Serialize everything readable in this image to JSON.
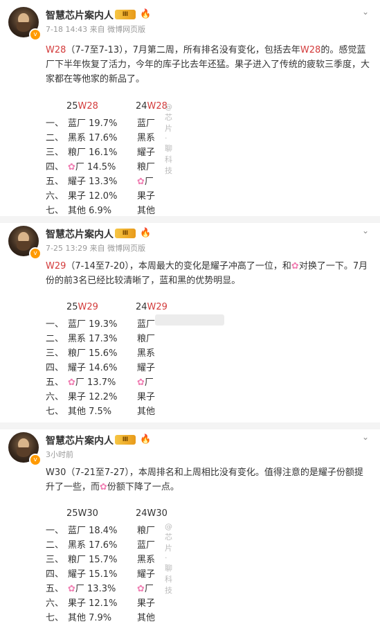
{
  "posts": [
    {
      "username": "智慧芯片案内人",
      "vip_label": "Ⅲ",
      "meta": "7-18 14:43  来自 微博网页版",
      "text_parts": [
        "W28",
        "（7-7至7-13），7月第二周，所有排名没有变化，包括去年",
        "W28",
        "的。感觉蓝厂下半年恢复了活力，今年的库子比去年还猛。果子进入了传统的疲软三季度，大家都在等他家的新品了。"
      ],
      "header_cur_prefix": "25",
      "header_cur_week": "W28",
      "header_prev_prefix": "24",
      "header_prev_week": "W28",
      "watermark": "@ 芯片·聊科技",
      "rows": [
        {
          "idx": "一、",
          "cur": "蓝厂 19.7%",
          "prev": "蓝厂"
        },
        {
          "idx": "二、",
          "cur": "黑系 17.6%",
          "prev": "黑系"
        },
        {
          "idx": "三、",
          "cur": "粮厂 16.1%",
          "prev": "耀子"
        },
        {
          "idx": "四、",
          "cur": "厂 14.5%",
          "cur_flower": true,
          "prev": "粮厂"
        },
        {
          "idx": "五、",
          "cur": "耀子 13.3%",
          "prev": "厂",
          "prev_flower": true
        },
        {
          "idx": "六、",
          "cur": "果子  12.0%",
          "prev": "果子"
        },
        {
          "idx": "七、",
          "cur": "其他  6.9%",
          "prev": "其他"
        }
      ]
    },
    {
      "username": "智慧芯片案内人",
      "vip_label": "Ⅲ",
      "meta": "7-25 13:29  来自 微博网页版",
      "text_parts": [
        "W29",
        "（7-14至7-20），本周最大的变化是耀子冲高了一位，和",
        "对换了一下。7月份的前3名已经比较清晰了，蓝和黑的优势明显。"
      ],
      "header_cur_prefix": "25",
      "header_cur_week": "W29",
      "header_prev_prefix": "24",
      "header_prev_week": "W29",
      "rows": [
        {
          "idx": "一、",
          "cur": "蓝厂 19.3%",
          "prev": "蓝厂"
        },
        {
          "idx": "二、",
          "cur": "黑系 17.3%",
          "prev": "粮厂"
        },
        {
          "idx": "三、",
          "cur": "粮厂 15.6%",
          "prev": "黑系"
        },
        {
          "idx": "四、",
          "cur": "耀子 14.6%",
          "prev": "耀子"
        },
        {
          "idx": "五、",
          "cur": "厂 13.7%",
          "cur_flower": true,
          "prev": "厂",
          "prev_flower": true
        },
        {
          "idx": "六、",
          "cur": "果子  12.2%",
          "prev": "果子"
        },
        {
          "idx": "七、",
          "cur": "其他  7.5%",
          "prev": "其他"
        }
      ]
    },
    {
      "username": "智慧芯片案内人",
      "vip_label": "Ⅲ",
      "meta": "3小时前",
      "text_parts": [
        "W30（7-21至7-27），本周排名和上周相比没有变化。值得注意的是耀子份额提升了一些，而",
        "份额下降了一点。"
      ],
      "header_cur": "25W30",
      "header_prev": "24W30",
      "watermark": "@ 芯片·聊科技",
      "rows": [
        {
          "idx": "一、",
          "cur": "蓝厂 18.4%",
          "prev": "粮厂"
        },
        {
          "idx": "二、",
          "cur": "黑系 17.6%",
          "prev": "蓝厂"
        },
        {
          "idx": "三、",
          "cur": "粮厂 15.7%",
          "prev": "黑系"
        },
        {
          "idx": "四、",
          "cur": "耀子 15.1%",
          "prev": "耀子"
        },
        {
          "idx": "五、",
          "cur": "厂 13.3%",
          "cur_flower": true,
          "prev": "厂",
          "prev_flower": true
        },
        {
          "idx": "六、",
          "cur": "果子  12.1%",
          "prev": "果子"
        },
        {
          "idx": "七、",
          "cur": "其他  7.9%",
          "prev": "其他"
        }
      ]
    }
  ],
  "icons": {
    "flower": "flower-icon",
    "fire": "fire-icon",
    "chevron": "chevron-down-icon",
    "verify": "verified-badge-icon"
  },
  "colors": {
    "highlight": "#d33b3b",
    "flower": "#f07fb3",
    "vip": "#f6c644"
  }
}
